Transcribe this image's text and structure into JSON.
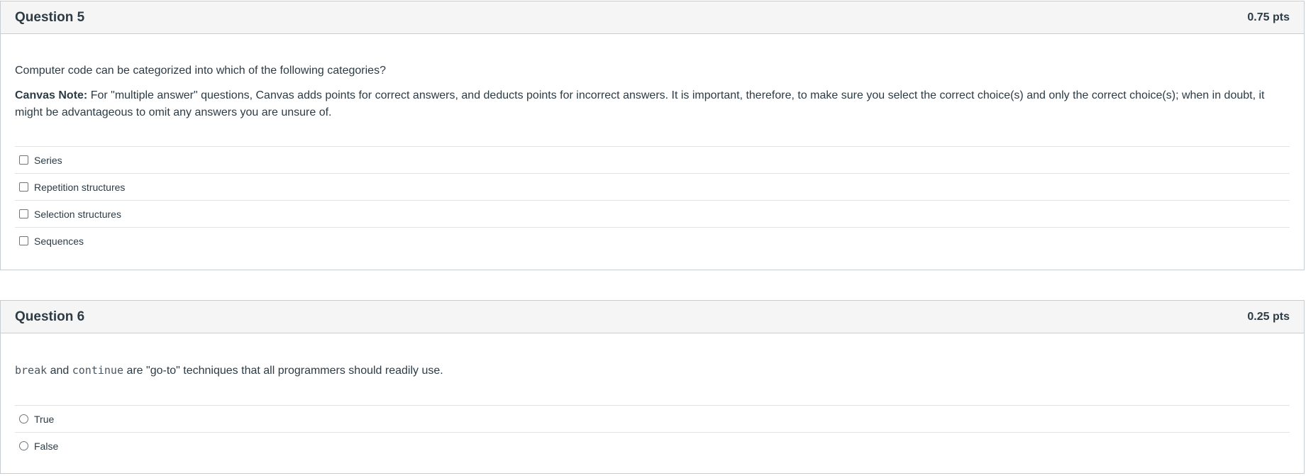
{
  "questions": [
    {
      "title": "Question 5",
      "points": "0.75 pts",
      "prompt": "Computer code can be categorized into which of the following categories?",
      "note_label": "Canvas Note:",
      "note_text": " For \"multiple answer\" questions, Canvas adds points for correct answers, and deducts points for incorrect answers. It is important, therefore, to make sure you select the correct choice(s) and only the correct choice(s); when in doubt, it might be advantageous to omit any answers you are unsure of.",
      "answer_type": "checkbox",
      "answers": [
        {
          "label": "Series",
          "checked": false
        },
        {
          "label": "Repetition structures",
          "checked": false
        },
        {
          "label": "Selection structures",
          "checked": false
        },
        {
          "label": "Sequences",
          "checked": false
        }
      ]
    },
    {
      "title": "Question 6",
      "points": "0.25 pts",
      "prompt_code_1": "break",
      "prompt_text_1": " and ",
      "prompt_code_2": "continue",
      "prompt_text_2": " are \"go-to\" techniques that all programmers should readily use.",
      "answer_type": "radio",
      "answers": [
        {
          "label": "True",
          "checked": false
        },
        {
          "label": "False",
          "checked": false
        }
      ]
    }
  ]
}
